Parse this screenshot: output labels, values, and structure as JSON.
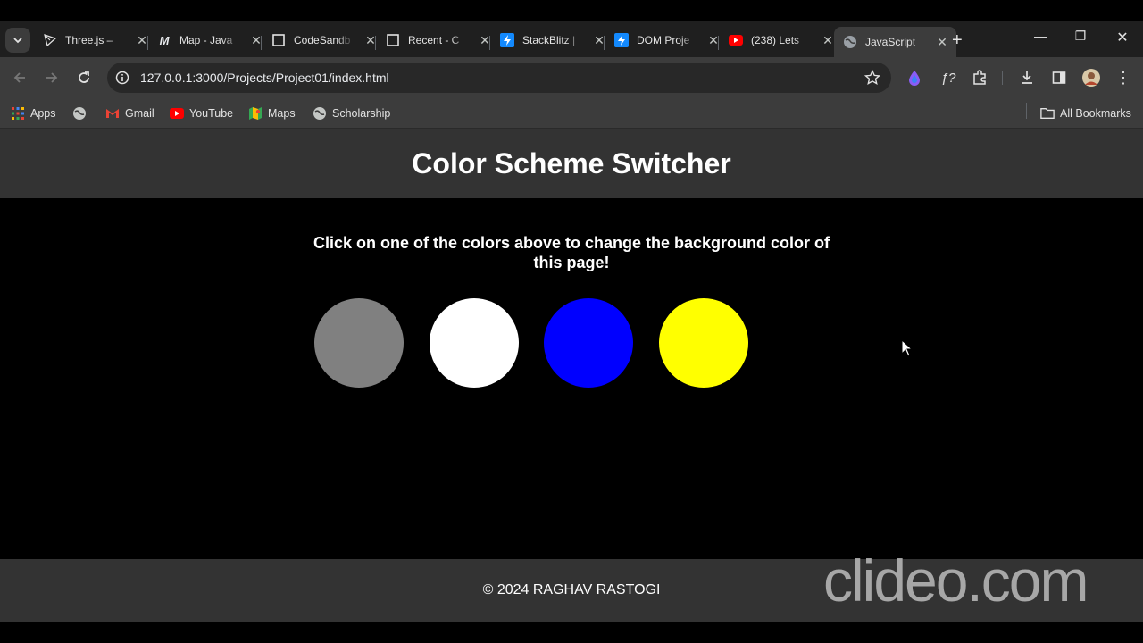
{
  "browser": {
    "tabs": [
      {
        "title": "Three.js – ",
        "icon": "threejs-icon"
      },
      {
        "title": "Map - Java",
        "icon": "medium-icon"
      },
      {
        "title": "CodeSandb",
        "icon": "codesandbox-icon"
      },
      {
        "title": "Recent - C",
        "icon": "codesandbox-icon"
      },
      {
        "title": "StackBlitz |",
        "icon": "stackblitz-icon"
      },
      {
        "title": "DOM Proje",
        "icon": "stackblitz-icon"
      },
      {
        "title": "(238) Lets ",
        "icon": "youtube-icon"
      },
      {
        "title": "JavaScript",
        "icon": "globe-icon",
        "active": true
      }
    ],
    "url": "127.0.0.1:3000/Projects/Project01/index.html",
    "bookmarks": {
      "apps": "Apps",
      "gmail": "Gmail",
      "youtube": "YouTube",
      "maps": "Maps",
      "scholarship": "Scholarship",
      "all": "All Bookmarks"
    },
    "toolbar_extension_label": "ƒ?"
  },
  "page": {
    "title": "Color Scheme Switcher",
    "instructions": "Click on one of the colors above to change the background color of this page!",
    "swatches": [
      {
        "name": "grey",
        "color": "#808080"
      },
      {
        "name": "white",
        "color": "#ffffff"
      },
      {
        "name": "blue",
        "color": "#0000ff"
      },
      {
        "name": "yellow",
        "color": "#ffff00"
      }
    ],
    "footer": "© 2024 RAGHAV RASTOGI",
    "background_color": "#000000"
  },
  "watermark": "clideo.com"
}
